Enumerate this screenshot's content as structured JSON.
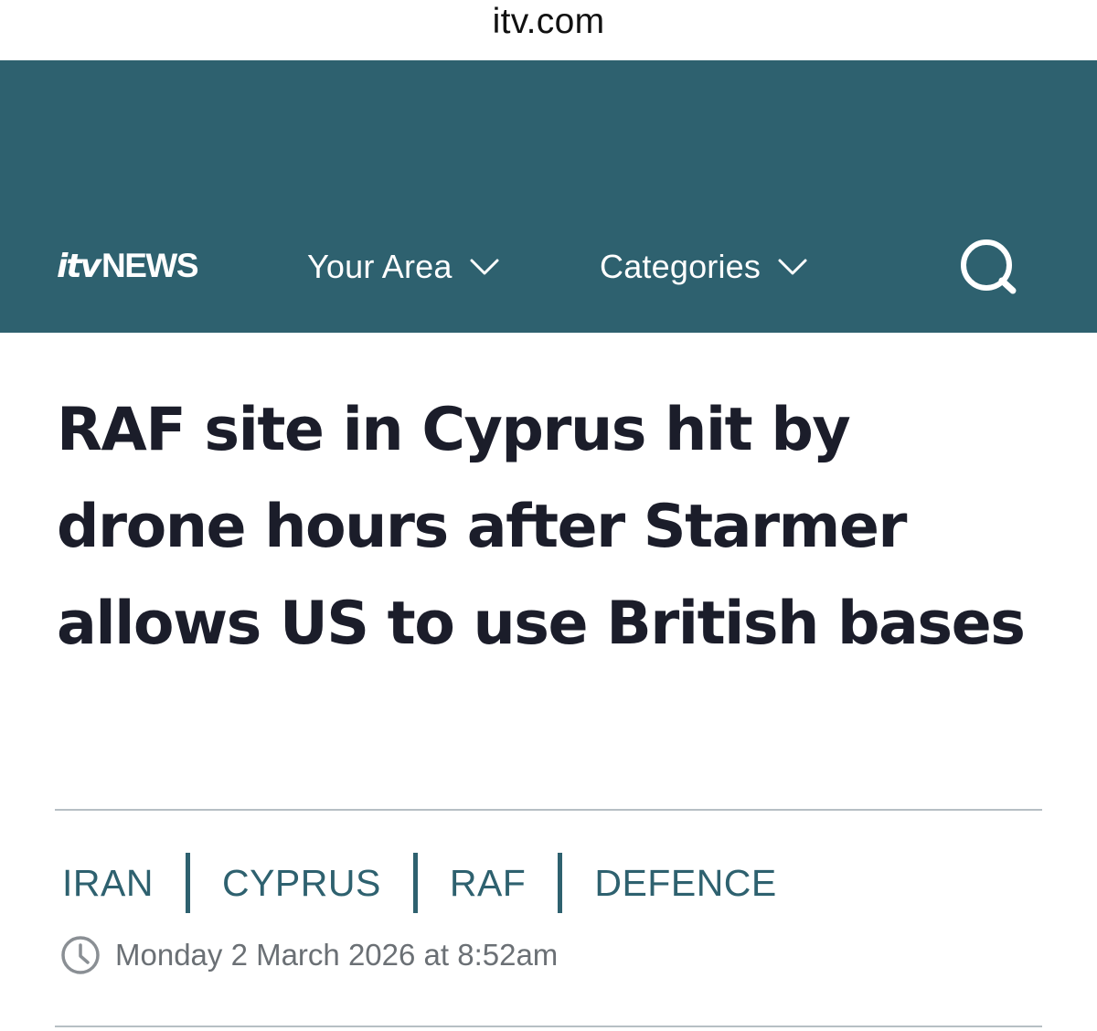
{
  "browser": {
    "url": "itv.com"
  },
  "header": {
    "logo_itv": "itv",
    "logo_news": "NEWS",
    "nav": [
      {
        "label": "Your Area",
        "icon": "chevron-down-icon"
      },
      {
        "label": "Categories",
        "icon": "chevron-down-icon"
      }
    ],
    "search_icon": "search-icon",
    "background_color": "#2e616f"
  },
  "article": {
    "headline": "RAF site in Cyprus hit by drone hours after Starmer allows US to use British bases",
    "tags": [
      "IRAN",
      "CYPRUS",
      "RAF",
      "DEFENCE"
    ],
    "date": "Monday 2 March 2026 at 8:52am",
    "date_icon": "clock-icon",
    "tag_color": "#2e616f"
  }
}
